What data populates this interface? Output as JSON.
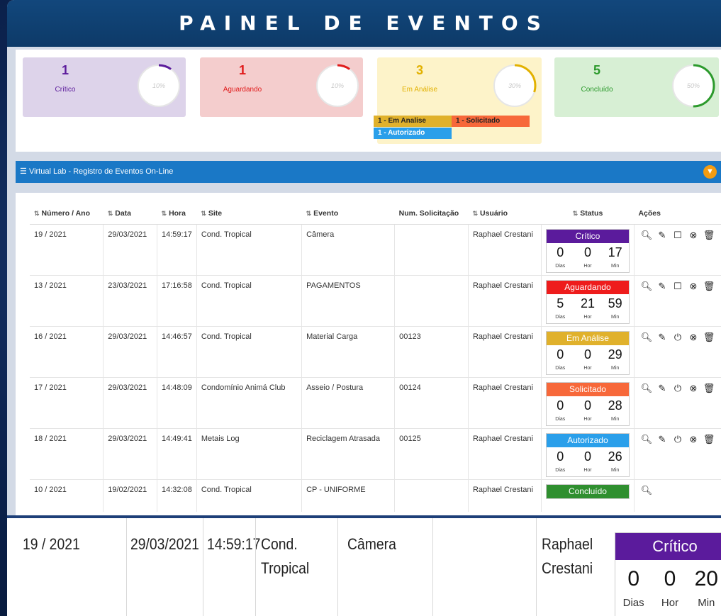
{
  "header": {
    "title": "PAINEL DE EVENTOS"
  },
  "cards": [
    {
      "count": "1",
      "label": "Crítico",
      "percent": "10%",
      "fraction": 0.1,
      "bg": "#ddd3ea",
      "color": "#5b1b9c"
    },
    {
      "count": "1",
      "label": "Aguardando",
      "percent": "10%",
      "fraction": 0.1,
      "bg": "#f4cdcd",
      "color": "#e01b1b"
    },
    {
      "count": "3",
      "label": "Em Análise",
      "percent": "30%",
      "fraction": 0.3,
      "bg": "#fdf3c9",
      "color": "#e2b100"
    },
    {
      "count": "5",
      "label": "Concluído",
      "percent": "50%",
      "fraction": 0.5,
      "bg": "#d7efd4",
      "color": "#2c9a2c"
    }
  ],
  "analysis_breakdown": {
    "em_analise": "1 - Em Analise",
    "solicitado": "1 - Solicitado",
    "autorizado": "1 - Autorizado"
  },
  "list_header": {
    "title": "Virtual Lab - Registro de Eventos On-Line",
    "filter_icon": "filter-icon"
  },
  "table": {
    "columns": [
      "Número / Ano",
      "Data",
      "Hora",
      "Site",
      "Evento",
      "Num. Solicitação",
      "Usuário",
      "Status",
      "Ações"
    ],
    "timer_units": {
      "days": "Dias",
      "hours": "Hor",
      "minutes": "Min"
    },
    "rows": [
      {
        "numero": "19 / 2021",
        "data": "29/03/2021",
        "hora": "14:59:17",
        "site": "Cond. Tropical",
        "evento": "Câmera",
        "num_solicitacao": "",
        "usuario": "Raphael Crestani",
        "status": "Crítico",
        "status_color": "#5b1b9c",
        "dias": "0",
        "hor": "0",
        "min": "17",
        "actions": [
          "search-icon",
          "edit-icon",
          "comment-icon",
          "close-circle-icon",
          "trash-icon"
        ]
      },
      {
        "numero": "13 / 2021",
        "data": "23/03/2021",
        "hora": "17:16:58",
        "site": "Cond. Tropical",
        "evento": "PAGAMENTOS",
        "num_solicitacao": "",
        "usuario": "Raphael Crestani",
        "status": "Aguardando",
        "status_color": "#ee1c1c",
        "dias": "5",
        "hor": "21",
        "min": "59",
        "actions": [
          "search-icon",
          "edit-icon",
          "comment-icon",
          "close-circle-icon",
          "trash-icon"
        ]
      },
      {
        "numero": "16 / 2021",
        "data": "29/03/2021",
        "hora": "14:46:57",
        "site": "Cond. Tropical",
        "evento": "Material Carga",
        "num_solicitacao": "00123",
        "usuario": "Raphael Crestani",
        "status": "Em Análise",
        "status_color": "#e0b12c",
        "dias": "0",
        "hor": "0",
        "min": "29",
        "actions": [
          "search-icon",
          "edit-icon",
          "power-icon",
          "close-circle-icon",
          "trash-icon"
        ]
      },
      {
        "numero": "17 / 2021",
        "data": "29/03/2021",
        "hora": "14:48:09",
        "site": "Condomínio Animá Club",
        "evento": "Asseio / Postura",
        "num_solicitacao": "00124",
        "usuario": "Raphael Crestani",
        "status": "Solicitado",
        "status_color": "#f7683a",
        "dias": "0",
        "hor": "0",
        "min": "28",
        "actions": [
          "search-icon",
          "edit-icon",
          "power-icon",
          "close-circle-icon",
          "trash-icon"
        ]
      },
      {
        "numero": "18 / 2021",
        "data": "29/03/2021",
        "hora": "14:49:41",
        "site": "Metais Log",
        "evento": "Reciclagem Atrasada",
        "num_solicitacao": "00125",
        "usuario": "Raphael Crestani",
        "status": "Autorizado",
        "status_color": "#2a9fea",
        "dias": "0",
        "hor": "0",
        "min": "26",
        "actions": [
          "search-icon",
          "edit-icon",
          "power-icon",
          "close-circle-icon",
          "trash-icon"
        ]
      },
      {
        "numero": "10 / 2021",
        "data": "19/02/2021",
        "hora": "14:32:08",
        "site": "Cond. Tropical",
        "evento": "CP - UNIFORME",
        "num_solicitacao": "",
        "usuario": "Raphael Crestani",
        "status": "Concluído",
        "status_color": "#2f8f2f",
        "dias": null,
        "hor": null,
        "min": null,
        "actions": [
          "search-icon"
        ]
      }
    ]
  },
  "zoom_row": {
    "numero": "19 / 2021",
    "data": "29/03/2021",
    "hora": "14:59:17",
    "site_line1": "Cond.",
    "site_line2": "Tropical",
    "evento": "Câmera",
    "usuario_line1": "Raphael",
    "usuario_line2": "Crestani",
    "status": "Crítico",
    "dias": "0",
    "hor": "0",
    "min": "20",
    "unit_days": "Dias",
    "unit_hours": "Hor",
    "unit_minutes": "Min"
  }
}
